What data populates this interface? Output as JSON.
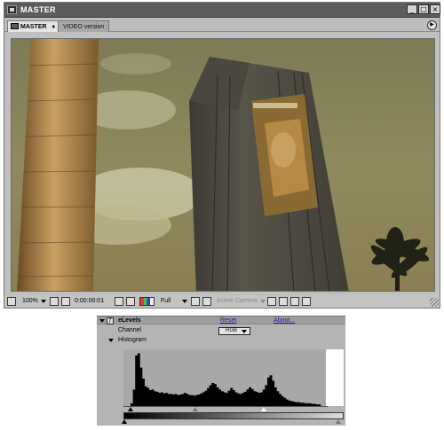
{
  "window": {
    "title": "MASTER",
    "controls": {
      "minimize": "_",
      "maximize": "□",
      "close": "×"
    }
  },
  "tabs": [
    {
      "label": "MASTER",
      "active": true,
      "close_glyph": "♦"
    },
    {
      "label": "VIDEO version",
      "active": false
    }
  ],
  "tab_menu_icon": "arrow-right-icon",
  "viewer": {
    "description_icon": "composition-frame",
    "colors": {
      "sky": "#8f8a5e",
      "cloud": "#c9c4a2",
      "building": "#4c4a44",
      "palm_trunk": "#b08a4e"
    }
  },
  "toolbar": {
    "zoom": "100%",
    "timecode": "0:00:00:01",
    "resolution": "Full",
    "camera": "Active Camera"
  },
  "effect": {
    "name": "eLevels",
    "reset_label": "Reset",
    "about_label": "About...",
    "channel_label": "Channel",
    "channel_value": "RGB",
    "histogram_label": "Histogram"
  },
  "histogram": {
    "values": [
      0.05,
      0.3,
      0.92,
      0.96,
      0.7,
      0.5,
      0.36,
      0.33,
      0.29,
      0.3,
      0.27,
      0.26,
      0.24,
      0.25,
      0.23,
      0.24,
      0.22,
      0.22,
      0.21,
      0.22,
      0.2,
      0.21,
      0.22,
      0.24,
      0.22,
      0.2,
      0.2,
      0.19,
      0.2,
      0.21,
      0.23,
      0.25,
      0.28,
      0.33,
      0.38,
      0.42,
      0.4,
      0.34,
      0.3,
      0.27,
      0.25,
      0.24,
      0.28,
      0.33,
      0.29,
      0.25,
      0.23,
      0.22,
      0.24,
      0.26,
      0.3,
      0.34,
      0.31,
      0.27,
      0.26,
      0.24,
      0.25,
      0.3,
      0.38,
      0.52,
      0.56,
      0.46,
      0.34,
      0.27,
      0.22,
      0.18,
      0.15,
      0.12,
      0.1,
      0.09,
      0.08,
      0.07,
      0.07,
      0.06,
      0.06,
      0.05,
      0.05,
      0.05,
      0.04,
      0.04,
      0.03,
      0.03
    ],
    "input_black": 0,
    "input_gamma": 0.34,
    "input_white": 0.7,
    "output_white": 0.97
  }
}
